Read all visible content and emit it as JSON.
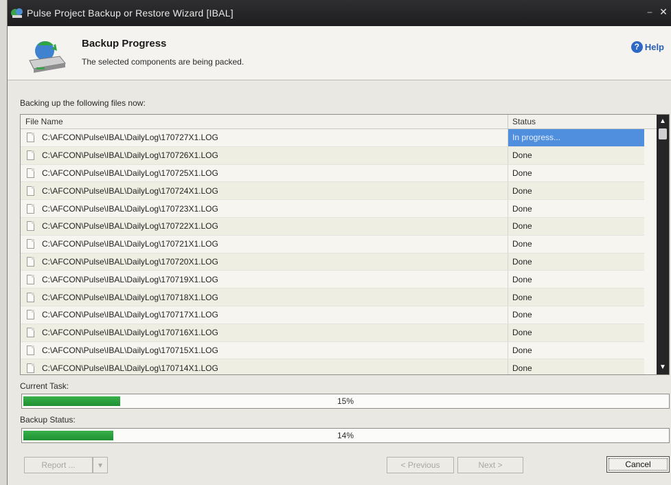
{
  "window": {
    "title": "Pulse Project Backup or Restore Wizard [IBAL]",
    "minimize_glyph": "–",
    "close_glyph": "✕"
  },
  "header": {
    "heading": "Backup Progress",
    "subheading": "The selected components are being packed.",
    "help_label": "Help",
    "help_glyph": "?"
  },
  "files_label": "Backing up the following files now:",
  "table": {
    "columns": {
      "file": "File Name",
      "status": "Status"
    },
    "rows": [
      {
        "file": "C:\\AFCON\\Pulse\\IBAL\\DailyLog\\170727X1.LOG",
        "status": "In progress..."
      },
      {
        "file": "C:\\AFCON\\Pulse\\IBAL\\DailyLog\\170726X1.LOG",
        "status": "Done"
      },
      {
        "file": "C:\\AFCON\\Pulse\\IBAL\\DailyLog\\170725X1.LOG",
        "status": "Done"
      },
      {
        "file": "C:\\AFCON\\Pulse\\IBAL\\DailyLog\\170724X1.LOG",
        "status": "Done"
      },
      {
        "file": "C:\\AFCON\\Pulse\\IBAL\\DailyLog\\170723X1.LOG",
        "status": "Done"
      },
      {
        "file": "C:\\AFCON\\Pulse\\IBAL\\DailyLog\\170722X1.LOG",
        "status": "Done"
      },
      {
        "file": "C:\\AFCON\\Pulse\\IBAL\\DailyLog\\170721X1.LOG",
        "status": "Done"
      },
      {
        "file": "C:\\AFCON\\Pulse\\IBAL\\DailyLog\\170720X1.LOG",
        "status": "Done"
      },
      {
        "file": "C:\\AFCON\\Pulse\\IBAL\\DailyLog\\170719X1.LOG",
        "status": "Done"
      },
      {
        "file": "C:\\AFCON\\Pulse\\IBAL\\DailyLog\\170718X1.LOG",
        "status": "Done"
      },
      {
        "file": "C:\\AFCON\\Pulse\\IBAL\\DailyLog\\170717X1.LOG",
        "status": "Done"
      },
      {
        "file": "C:\\AFCON\\Pulse\\IBAL\\DailyLog\\170716X1.LOG",
        "status": "Done"
      },
      {
        "file": "C:\\AFCON\\Pulse\\IBAL\\DailyLog\\170715X1.LOG",
        "status": "Done"
      },
      {
        "file": "C:\\AFCON\\Pulse\\IBAL\\DailyLog\\170714X1.LOG",
        "status": "Done"
      }
    ]
  },
  "current_task": {
    "label": "Current Task:",
    "percent_text": "15%",
    "percent": 15
  },
  "backup_status": {
    "label": "Backup Status:",
    "percent_text": "14%",
    "percent": 14
  },
  "footer": {
    "report_label": "Report ...",
    "previous_label": "< Previous",
    "next_label": "Next >",
    "cancel_label": "Cancel"
  },
  "colors": {
    "progress_green": "#2fa443",
    "selection_blue": "#4f8fdd",
    "help_blue": "#2d68c4"
  }
}
